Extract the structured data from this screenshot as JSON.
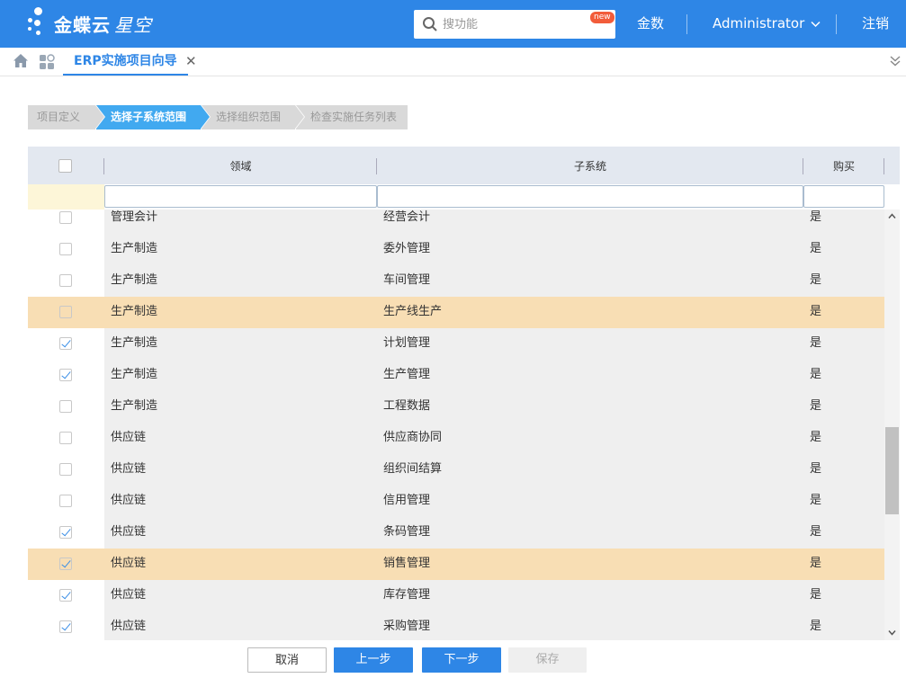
{
  "header": {
    "brand": "金蝶云",
    "brand_sub": "星空",
    "search_placeholder": "搜功能",
    "new_badge": "new",
    "nav": [
      "金数",
      "Administrator",
      "注销"
    ]
  },
  "tabbar": {
    "active_tab": "ERP实施项目向导"
  },
  "wizard": {
    "steps": [
      "项目定义",
      "选择子系统范围",
      "选择组织范围",
      "检查实施任务列表"
    ],
    "active_index": 1
  },
  "grid": {
    "columns": [
      "领域",
      "子系统",
      "购买"
    ],
    "rows": [
      {
        "checked": false,
        "domain": "管理会计",
        "subsystem": "经营会计",
        "purchased": "是",
        "highlight": false
      },
      {
        "checked": false,
        "domain": "生产制造",
        "subsystem": "委外管理",
        "purchased": "是",
        "highlight": false
      },
      {
        "checked": false,
        "domain": "生产制造",
        "subsystem": "车间管理",
        "purchased": "是",
        "highlight": false
      },
      {
        "checked": false,
        "domain": "生产制造",
        "subsystem": "生产线生产",
        "purchased": "是",
        "highlight": true
      },
      {
        "checked": true,
        "domain": "生产制造",
        "subsystem": "计划管理",
        "purchased": "是",
        "highlight": false
      },
      {
        "checked": true,
        "domain": "生产制造",
        "subsystem": "生产管理",
        "purchased": "是",
        "highlight": false
      },
      {
        "checked": false,
        "domain": "生产制造",
        "subsystem": "工程数据",
        "purchased": "是",
        "highlight": false
      },
      {
        "checked": false,
        "domain": "供应链",
        "subsystem": "供应商协同",
        "purchased": "是",
        "highlight": false
      },
      {
        "checked": false,
        "domain": "供应链",
        "subsystem": "组织间结算",
        "purchased": "是",
        "highlight": false
      },
      {
        "checked": false,
        "domain": "供应链",
        "subsystem": "信用管理",
        "purchased": "是",
        "highlight": false
      },
      {
        "checked": true,
        "domain": "供应链",
        "subsystem": "条码管理",
        "purchased": "是",
        "highlight": false
      },
      {
        "checked": true,
        "domain": "供应链",
        "subsystem": "销售管理",
        "purchased": "是",
        "highlight": true
      },
      {
        "checked": true,
        "domain": "供应链",
        "subsystem": "库存管理",
        "purchased": "是",
        "highlight": false
      },
      {
        "checked": true,
        "domain": "供应链",
        "subsystem": "采购管理",
        "purchased": "是",
        "highlight": false
      }
    ]
  },
  "buttons": {
    "cancel": "取消",
    "prev": "上一步",
    "next": "下一步",
    "save": "保存"
  },
  "colors": {
    "primary": "#2e86e6",
    "step_active": "#41a9f0",
    "row_highlight": "#f8deb4"
  }
}
